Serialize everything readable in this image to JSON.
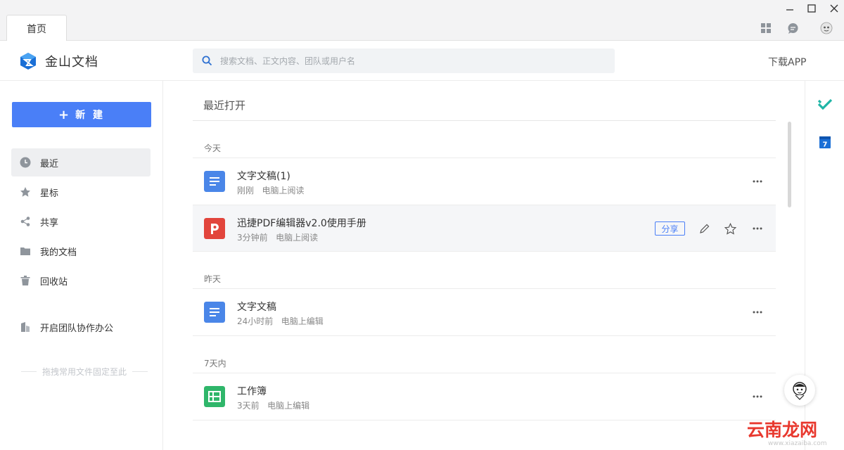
{
  "titlebar": {
    "tab_label": "首页"
  },
  "header": {
    "app_name": "金山文档",
    "search_placeholder": "搜索文档、正文内容、团队或用户名",
    "download_label": "下载APP"
  },
  "sidebar": {
    "new_label": "新 建",
    "items": [
      {
        "label": "最近",
        "icon": "clock-icon"
      },
      {
        "label": "星标",
        "icon": "star-icon"
      },
      {
        "label": "共享",
        "icon": "share-icon"
      },
      {
        "label": "我的文档",
        "icon": "folder-icon"
      },
      {
        "label": "回收站",
        "icon": "trash-icon"
      }
    ],
    "team_label": "开启团队协作办公",
    "pin_hint": "拖拽常用文件固定至此"
  },
  "main": {
    "title": "最近打开",
    "groups": [
      {
        "label": "今天"
      },
      {
        "label": "昨天"
      },
      {
        "label": "7天内"
      }
    ],
    "files": [
      {
        "name": "文字文稿(1)",
        "time": "刚刚",
        "action": "电脑上阅读",
        "type": "doc"
      },
      {
        "name": "迅捷PDF编辑器v2.0使用手册",
        "time": "3分钟前",
        "action": "电脑上阅读",
        "type": "pdf"
      },
      {
        "name": "文字文稿",
        "time": "24小时前",
        "action": "电脑上编辑",
        "type": "doc"
      },
      {
        "name": "工作簿",
        "time": "3天前",
        "action": "电脑上编辑",
        "type": "sheet"
      }
    ],
    "share_label": "分享"
  },
  "rail": {
    "calendar_day": "7"
  },
  "watermark": {
    "text": "云南龙网",
    "url": "www.xiazaiba.com"
  },
  "colors": {
    "accent": "#4a7ff7",
    "doc": "#4a86e8",
    "pdf": "#e2453c",
    "sheet": "#2fb66a",
    "task": "#1fb5a6"
  }
}
